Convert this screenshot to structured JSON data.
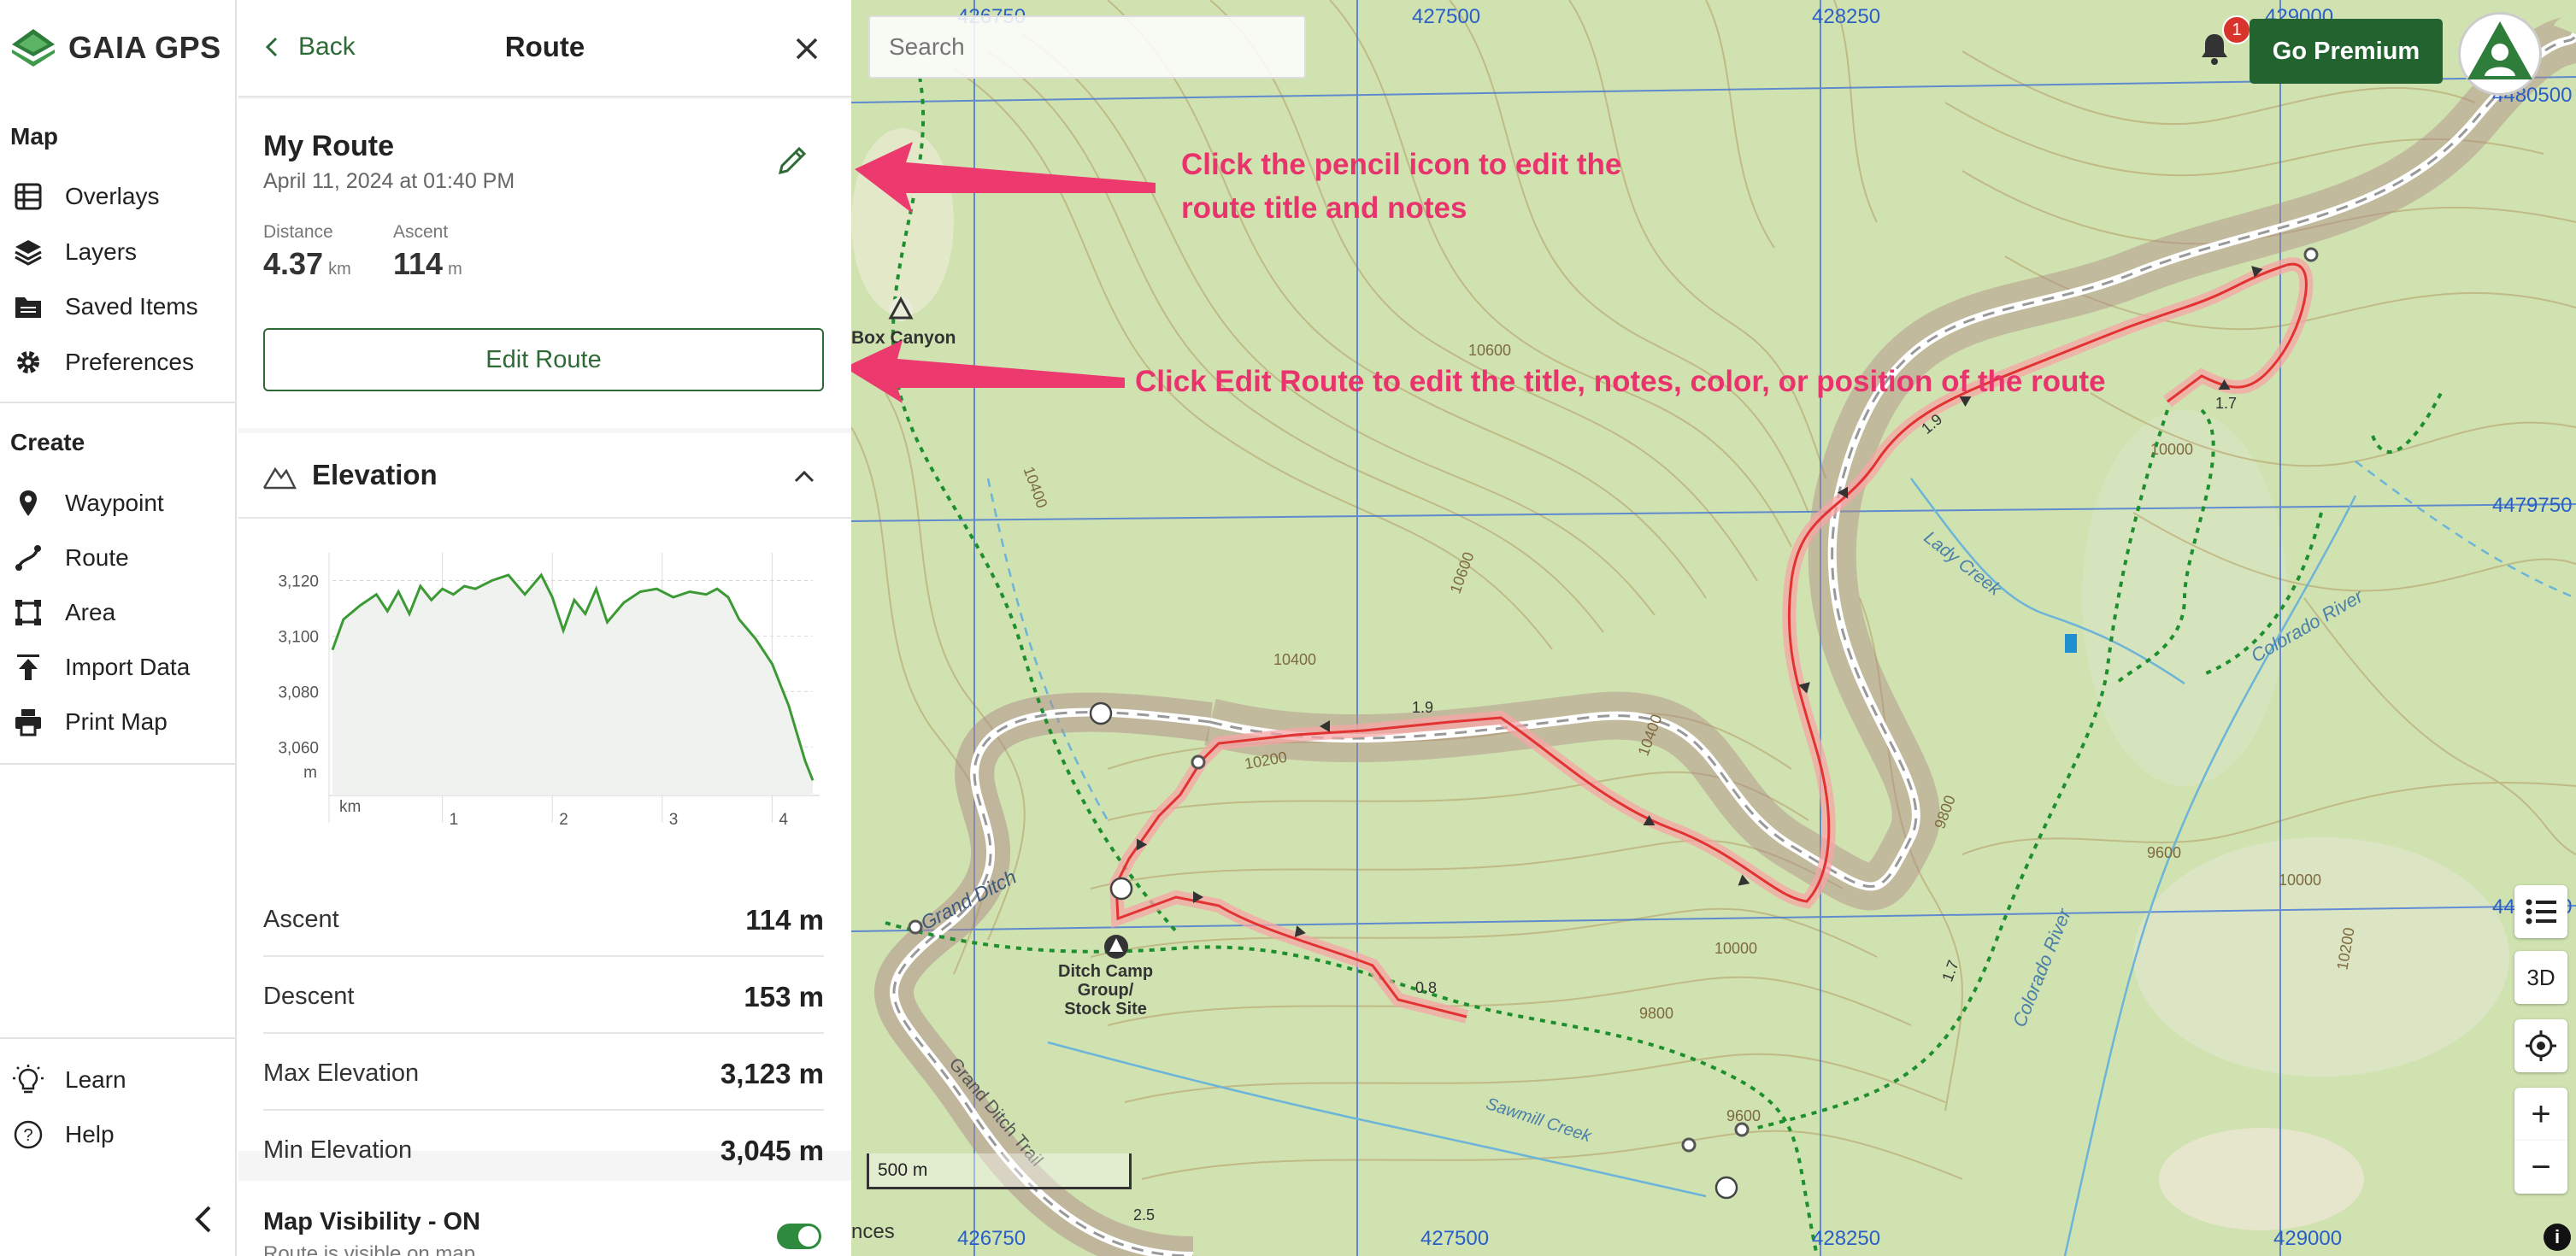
{
  "brand": {
    "name": "GAIA GPS"
  },
  "nav": {
    "map_heading": "Map",
    "map_items": [
      "Overlays",
      "Layers",
      "Saved Items",
      "Preferences"
    ],
    "create_heading": "Create",
    "create_items": [
      "Waypoint",
      "Route",
      "Area",
      "Import Data",
      "Print Map"
    ],
    "footer_items": [
      "Learn",
      "Help"
    ]
  },
  "panel": {
    "back_label": "Back",
    "title": "Route",
    "route_name": "My Route",
    "route_date": "April 11, 2024 at 01:40 PM",
    "distance_label": "Distance",
    "distance_value": "4.37",
    "distance_unit": "km",
    "ascent_label": "Ascent",
    "ascent_value": "114",
    "ascent_unit": "m",
    "edit_button": "Edit Route",
    "elevation_title": "Elevation",
    "stats": [
      {
        "label": "Ascent",
        "value": "114 m"
      },
      {
        "label": "Descent",
        "value": "153 m"
      },
      {
        "label": "Max Elevation",
        "value": "3,123 m"
      },
      {
        "label": "Min Elevation",
        "value": "3,045 m"
      }
    ],
    "visibility_title": "Map Visibility - ON",
    "visibility_sub": "Route is visible on map"
  },
  "chart_data": {
    "type": "line",
    "xlabel": "km",
    "ylabel": "m",
    "x_ticks": [
      "1",
      "2",
      "3",
      "4"
    ],
    "y_ticks": [
      "3,120",
      "3,100",
      "3,080",
      "3,060"
    ],
    "xlim": [
      0,
      4.37
    ],
    "ylim": [
      3045,
      3130
    ],
    "series": [
      {
        "x": [
          0,
          0.1,
          0.25,
          0.4,
          0.5,
          0.6,
          0.7,
          0.8,
          0.9,
          1.0,
          1.1,
          1.2,
          1.3,
          1.45,
          1.6,
          1.75,
          1.9,
          2.0,
          2.1,
          2.2,
          2.3,
          2.4,
          2.5,
          2.65,
          2.8,
          2.95,
          3.1,
          3.25,
          3.4,
          3.5,
          3.6,
          3.7,
          3.85,
          4.0,
          4.15,
          4.3,
          4.37
        ],
        "y": [
          3095,
          3106,
          3111,
          3115,
          3109,
          3116,
          3108,
          3118,
          3113,
          3117,
          3115,
          3118,
          3117,
          3120,
          3122,
          3115,
          3122,
          3114,
          3102,
          3113,
          3108,
          3117,
          3105,
          3112,
          3116,
          3117,
          3114,
          3116,
          3115,
          3117,
          3114,
          3106,
          3099,
          3090,
          3075,
          3055,
          3048
        ]
      }
    ]
  },
  "map": {
    "search_placeholder": "Search",
    "notification_count": "1",
    "premium_label": "Go Premium",
    "button_3d": "3D",
    "zoom_in": "+",
    "zoom_out": "−",
    "scale_label": "500 m",
    "attribution": "nces",
    "info_label": "i",
    "coords_top": [
      "426750",
      "427500",
      "428250",
      "429000"
    ],
    "coords_bottom": [
      "426750",
      "427500",
      "428250",
      "429000"
    ],
    "coords_right": [
      "4480500",
      "4479750",
      "4479000"
    ],
    "labels": {
      "box_canyon": "Box Canyon",
      "ditch_camp": [
        "Ditch Camp",
        "Group/",
        "Stock Site"
      ],
      "grand_ditch": "Grand Ditch",
      "grand_ditch_trail": "Grand Ditch Trail",
      "lady_creek": "Lady Creek",
      "colorado_river": "Colorado River",
      "sawmill_creek": "Sawmill Creek",
      "contours": [
        "10600",
        "10600",
        "10400",
        "10200",
        "10400",
        "10000",
        "10000",
        "9800",
        "9600",
        "9600",
        "10000",
        "10200",
        "9800",
        "10400"
      ],
      "route_dists": [
        "1.9",
        "1.9",
        "1.7",
        "0.8",
        "1.7",
        "2.5"
      ]
    }
  },
  "annotations": {
    "pencil": [
      "Click the pencil icon to edit the",
      "route title and notes"
    ],
    "edit": "Click Edit Route to edit the title, notes, color, or position of the route"
  }
}
